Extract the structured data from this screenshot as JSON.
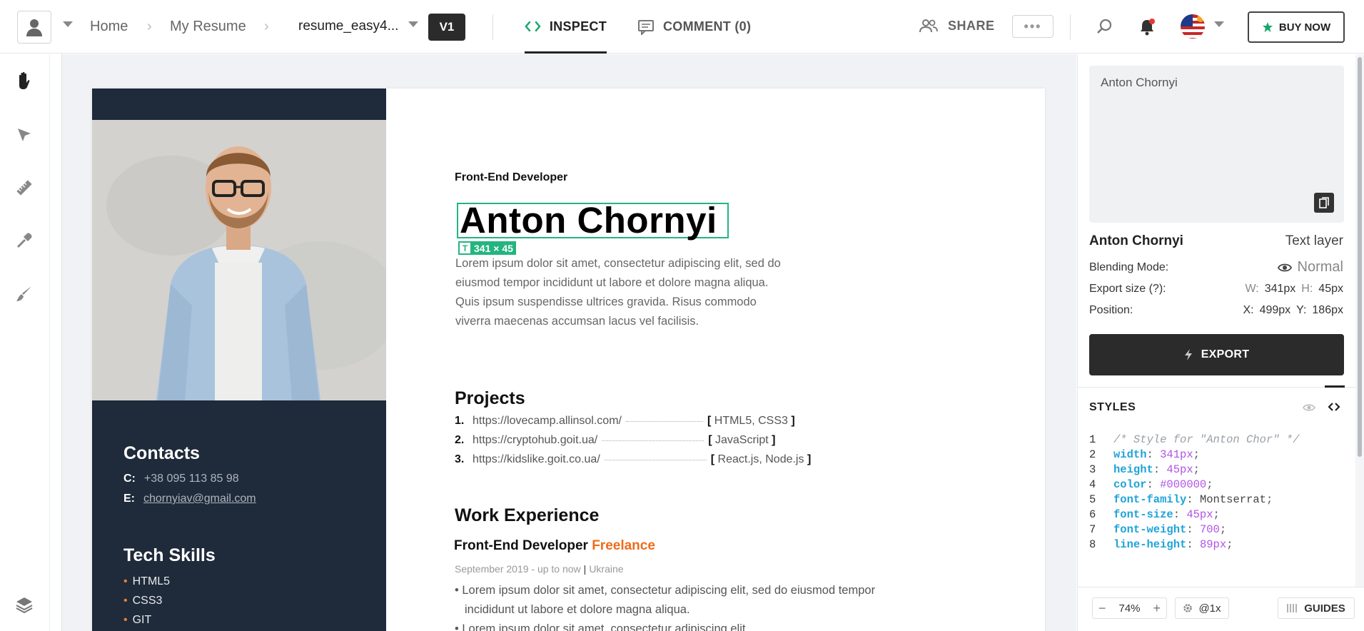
{
  "topbar": {
    "breadcrumbs": [
      "Home",
      "My Resume"
    ],
    "file_name": "resume_easy4...",
    "version": "V1",
    "tabs": {
      "inspect": "INSPECT",
      "comment": "COMMENT (0)"
    },
    "share": "SHARE",
    "more": "•••",
    "buy_now": "BUY NOW"
  },
  "tools": [
    "hand-icon",
    "pointer-icon",
    "ruler-icon",
    "eyedropper-icon",
    "brush-icon",
    "layers-icon"
  ],
  "resume": {
    "sidebar": {
      "contacts_title": "Contacts",
      "phone_label": "C:",
      "phone": "+38 095 113 85 98",
      "email_label": "E:",
      "email": "chornyiav@gmail.com",
      "skills_title": "Tech Skills",
      "skills": [
        "HTML5",
        "CSS3",
        "GIT"
      ]
    },
    "job_title": "Front-End Developer",
    "name": "Anton Chornyi",
    "selection_size": "341 × 45",
    "intro": "Lorem ipsum dolor sit amet, consectetur adipiscing elit, sed do eiusmod tempor incididunt ut labore et dolore magna aliqua. Quis ipsum suspendisse ultrices gravida. Risus commodo viverra maecenas accumsan lacus vel facilisis.",
    "projects_title": "Projects",
    "projects": [
      {
        "num": "1.",
        "url": "https://lovecamp.allinsol.com/",
        "tech": "HTML5, CSS3"
      },
      {
        "num": "2.",
        "url": "https://cryptohub.goit.ua/",
        "tech": "JavaScript"
      },
      {
        "num": "3.",
        "url": "https://kidslike.goit.co.ua/",
        "tech": "React.js, Node.js"
      }
    ],
    "work_title": "Work Experience",
    "work_role": "Front-End Developer",
    "work_company": "Freelance",
    "work_period": "September 2019 - up to now",
    "work_sep": "|",
    "work_location": "Ukraine",
    "work_bullets": [
      "Lorem ipsum dolor sit amet, consectetur adipiscing elit, sed do eiusmod tempor incididunt ut labore et dolore magna aliqua.",
      "Lorem ipsum dolor sit amet, consectetur adipiscing elit,"
    ]
  },
  "inspector": {
    "preview_text": "Anton Chornyi",
    "layer_name": "Anton Chornyi",
    "layer_type": "Text layer",
    "blending_label": "Blending Mode:",
    "blending_value": "Normal",
    "export_size_label": "Export size (?):",
    "w_label": "W:",
    "w_value": "341px",
    "h_label": "H:",
    "h_value": "45px",
    "position_label": "Position:",
    "x_label": "X:",
    "x_value": "499px",
    "y_label": "Y:",
    "y_value": "186px",
    "export_button": "EXPORT",
    "styles_title": "STYLES",
    "code": [
      {
        "n": "1",
        "comment": "/* Style for \"Anton Chor\" */"
      },
      {
        "n": "2",
        "prop": "width",
        "val": "341px"
      },
      {
        "n": "3",
        "prop": "height",
        "val": "45px"
      },
      {
        "n": "4",
        "prop": "color",
        "val": "#000000"
      },
      {
        "n": "5",
        "prop": "font-family",
        "plain": "Montserrat"
      },
      {
        "n": "6",
        "prop": "font-size",
        "val": "45px"
      },
      {
        "n": "7",
        "prop": "font-weight",
        "val": "700"
      },
      {
        "n": "8",
        "prop": "line-height",
        "val": "89px"
      }
    ],
    "zoom": "74%",
    "scale": "@1x",
    "guides": "GUIDES"
  },
  "colors": {
    "accent_green": "#24b57f",
    "accent_orange": "#ef6c1a",
    "sidebar_navy": "#1f2a3a"
  }
}
